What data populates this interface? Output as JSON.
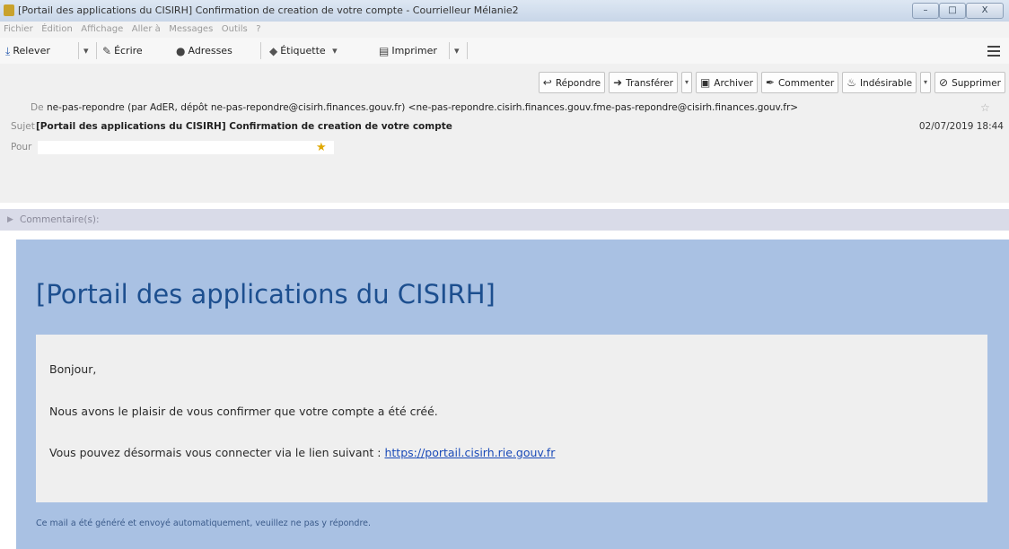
{
  "window": {
    "title": "[Portail des applications du CISIRH] Confirmation de creation de votre compte - Courrielleur Mélanie2",
    "minimize": "–",
    "maximize": "□",
    "close": "X"
  },
  "menubar": {
    "items": [
      "Fichier",
      "Édition",
      "Affichage",
      "Aller à",
      "Messages",
      "Outils",
      "?"
    ]
  },
  "toolbar": {
    "relever": "Relever",
    "ecrire": "Écrire",
    "adresses": "Adresses",
    "etiquette": "Étiquette",
    "imprimer": "Imprimer",
    "dropdown_glyph": "▾"
  },
  "actions": {
    "repondre": "Répondre",
    "transferer": "Transférer",
    "archiver": "Archiver",
    "commenter": "Commenter",
    "indesirable": "Indésirable",
    "supprimer": "Supprimer",
    "dropdown_glyph": "▾"
  },
  "header": {
    "from_label": "De",
    "from_value": "ne-pas-repondre (par AdER, dépôt ne-pas-repondre@cisirh.finances.gouv.fr) <ne-pas-repondre.cisirh.finances.gouv.fme-pas-repondre@cisirh.finances.gouv.fr>",
    "subject_label": "Sujet",
    "subject_value": "[Portail des applications du CISIRH] Confirmation de creation de votre compte",
    "date": "02/07/2019 18:44",
    "to_label": "Pour",
    "comments_label": "Commentaire(s):"
  },
  "body": {
    "title": "[Portail des applications du CISIRH]",
    "greeting": "Bonjour,",
    "line1": "Nous avons le plaisir de vous confirmer que votre compte a été créé.",
    "line2_prefix": "Vous pouvez désormais vous connecter via le lien suivant : ",
    "link": "https://portail.cisirh.rie.gouv.fr",
    "footer": "Ce mail a été généré et envoyé automatiquement, veuillez ne pas y répondre."
  },
  "colors": {
    "body_background": "#a9c1e3",
    "title_blue": "#1d4f8f",
    "link_blue": "#1a4ab8",
    "star": "#e0a800"
  },
  "icons": {
    "relever": "download-icon",
    "ecrire": "pencil-icon",
    "adresses": "address-book-icon",
    "etiquette": "tag-icon",
    "imprimer": "printer-icon",
    "repondre": "reply-icon",
    "transferer": "forward-icon",
    "archiver": "archive-icon",
    "commenter": "quill-icon",
    "indesirable": "junk-icon",
    "supprimer": "delete-icon"
  }
}
